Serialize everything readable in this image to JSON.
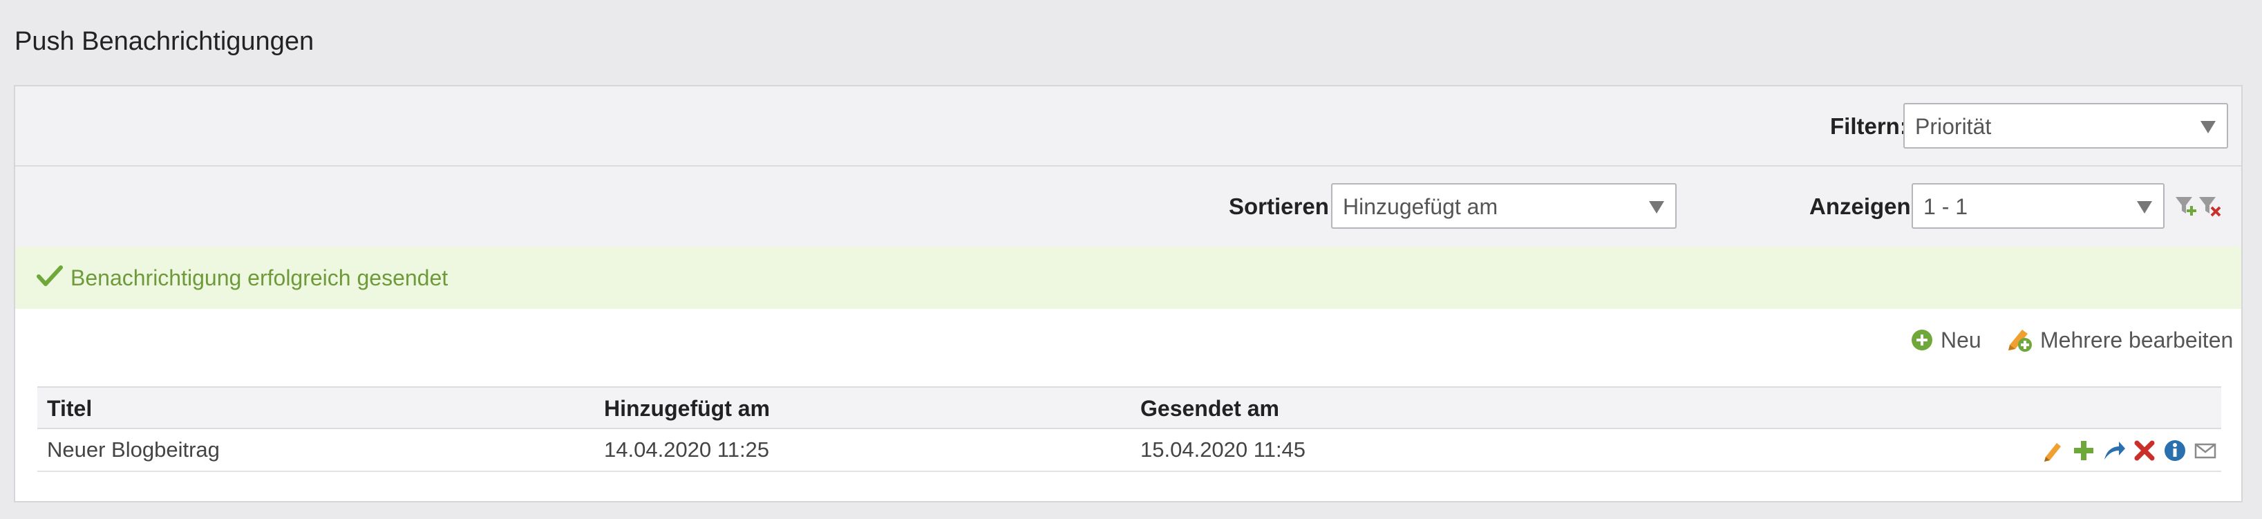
{
  "page": {
    "title": "Push Benachrichtigungen"
  },
  "filter": {
    "label": "Filtern:",
    "value": "Priorität"
  },
  "sort": {
    "label": "Sortieren:",
    "value": "Hinzugefügt am"
  },
  "display": {
    "label": "Anzeigen:",
    "value": "1 - 1"
  },
  "filter_icons": [
    "filter-add-icon",
    "filter-remove-icon"
  ],
  "message": {
    "text": "Benachrichtigung erfolgreich gesendet",
    "icon": "check-icon"
  },
  "actions": {
    "new_label": "Neu",
    "new_icon": "plus-circle-icon",
    "bulk_edit_label": "Mehrere bearbeiten",
    "bulk_edit_icon": "multi-edit-icon"
  },
  "table": {
    "headers": [
      "Titel",
      "Hinzugefügt am",
      "Gesendet am"
    ],
    "rows": [
      {
        "title": "Neuer Blogbeitrag",
        "added": "14.04.2020 11:25",
        "sent": "15.04.2020 11:45",
        "row_actions": [
          "edit-icon",
          "add-icon",
          "send-icon",
          "delete-icon",
          "info-icon",
          "mail-icon"
        ]
      }
    ]
  },
  "colors": {
    "success_text": "#6e9a3a",
    "success_bg": "#eef8e1",
    "green_icon": "#6fa83a",
    "red_icon": "#c9302c",
    "blue_icon": "#2a6fae"
  }
}
